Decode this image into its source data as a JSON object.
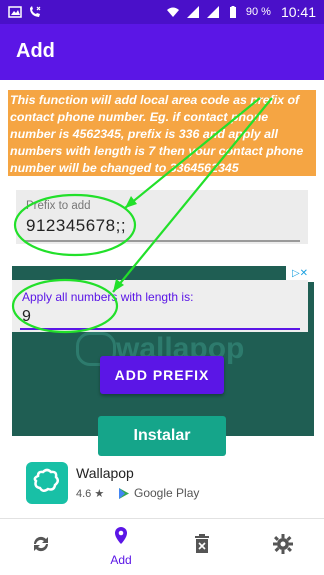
{
  "status_bar": {
    "battery": "90 %",
    "time": "10:41"
  },
  "app_bar": {
    "title": "Add"
  },
  "info_text": "This function will add local area code as prefix of contact phone number. Eg. if contact phone number is 4562345, prefix is 336 and apply all numbers with length is 7 then your contact phone number will be changed to 3364562345",
  "prefix_field": {
    "label": "Prefix to add",
    "value": "912345678;;"
  },
  "length_field": {
    "label": "Apply all numbers with length is:",
    "value": "9"
  },
  "add_prefix_button": "ADD PREFIX",
  "ad": {
    "brand_text": "wallapop",
    "install_button": "Instalar",
    "app_name": "Wallapop",
    "rating": "4.6 ★",
    "store": "Google Play",
    "ad_badge": "▷✕"
  },
  "bottom_nav": {
    "items": [
      {
        "icon": "sync-icon",
        "label": ""
      },
      {
        "icon": "location-pin-icon",
        "label": "Add"
      },
      {
        "icon": "delete-icon",
        "label": ""
      },
      {
        "icon": "settings-gear-icon",
        "label": ""
      }
    ],
    "active": 1
  },
  "colors": {
    "primary": "#5b16e6",
    "status_bar": "#4a10c9",
    "info_bg": "#f5a543",
    "annotation": "#22e02a",
    "ad_bg": "#1f5e53",
    "install": "#15a58a"
  }
}
